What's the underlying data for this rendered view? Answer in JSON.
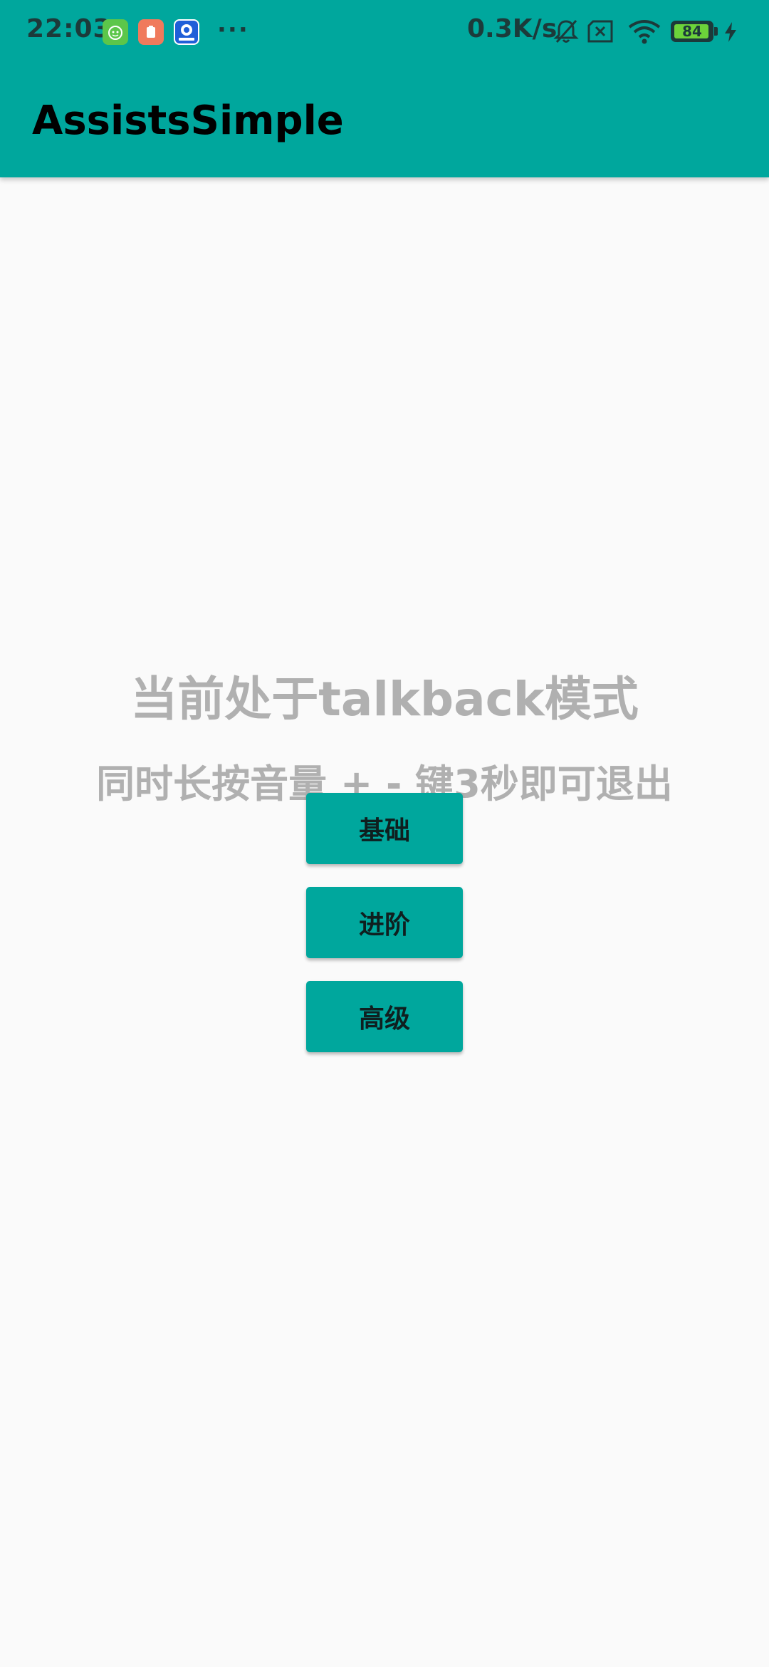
{
  "status_bar": {
    "time": "22:03",
    "more_indicator": "···",
    "net_speed": "0.3K/s",
    "battery_level": "84",
    "notification_icons": [
      "cat-app-icon",
      "clipboard-app-icon",
      "video-app-icon"
    ],
    "system_icons": [
      "bell-muted-icon",
      "sim-none-icon",
      "wifi-icon",
      "battery-icon",
      "charging-icon"
    ]
  },
  "app_bar": {
    "title": "AssistsSimple"
  },
  "main": {
    "headline": "当前处于talkback模式",
    "subline": "同时长按音量 + - 键3秒即可退出",
    "buttons": [
      {
        "label": "基础"
      },
      {
        "label": "进阶"
      },
      {
        "label": "高级"
      }
    ]
  },
  "colors": {
    "primary": "#00a79d",
    "background": "#fafafa",
    "hint_text": "#b0b0b0",
    "button_text": "#0f1f1f"
  }
}
